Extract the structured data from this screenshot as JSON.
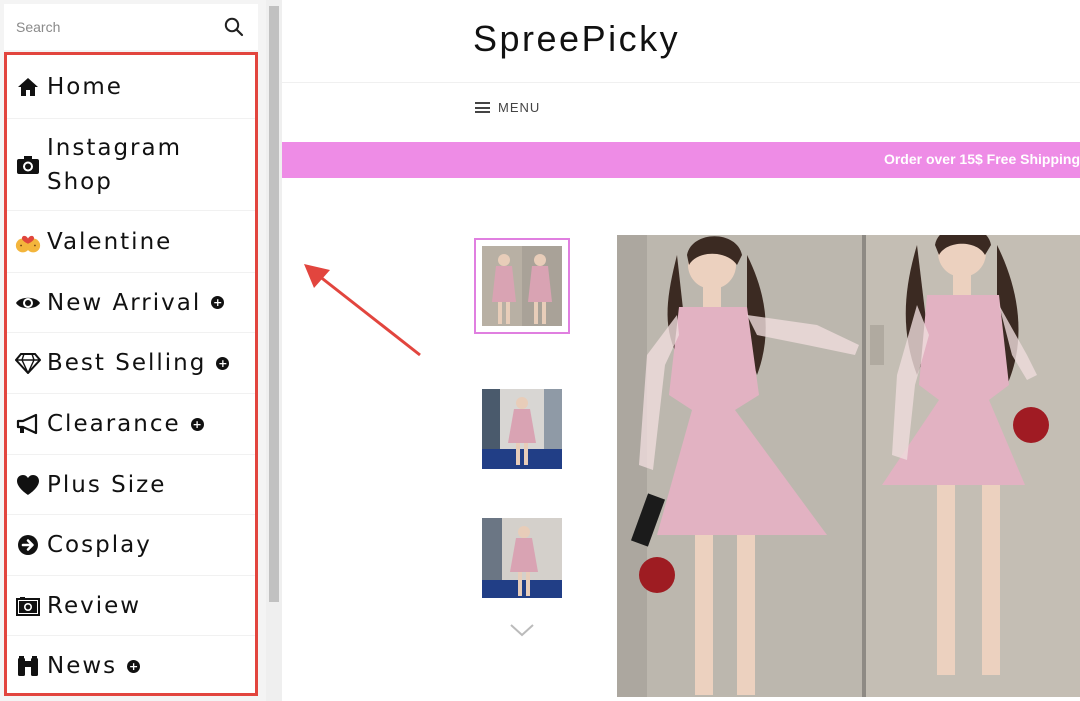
{
  "sidebar": {
    "search": {
      "placeholder": "Search"
    },
    "items": [
      {
        "label": "Home",
        "icon": "home-icon",
        "has_submenu": false
      },
      {
        "label": "Instagram Shop",
        "icon": "camera-icon",
        "has_submenu": false
      },
      {
        "label": "Valentine",
        "icon": "couple-kiss-icon",
        "has_submenu": false
      },
      {
        "label": "New Arrival",
        "icon": "eye-icon",
        "has_submenu": true
      },
      {
        "label": "Best Selling",
        "icon": "diamond-icon",
        "has_submenu": true
      },
      {
        "label": "Clearance",
        "icon": "megaphone-icon",
        "has_submenu": true
      },
      {
        "label": "Plus Size",
        "icon": "heart-icon",
        "has_submenu": false
      },
      {
        "label": "Cosplay",
        "icon": "arrow-circle-right-icon",
        "has_submenu": false
      },
      {
        "label": "Review",
        "icon": "photo-camera-icon",
        "has_submenu": false
      },
      {
        "label": "News",
        "icon": "binoculars-icon",
        "has_submenu": true
      }
    ],
    "highlight_color": "#e2453e"
  },
  "header": {
    "site_title": "SpreePicky",
    "menu_label": "MENU"
  },
  "promo": {
    "text": "Order over 15$ Free Shipping",
    "background": "#ee8ce6"
  },
  "product": {
    "thumbnails": [
      {
        "selected": true
      },
      {
        "selected": false
      },
      {
        "selected": false
      }
    ],
    "accent": "#e07fe0"
  },
  "annotation": {
    "color": "#e2453e"
  }
}
